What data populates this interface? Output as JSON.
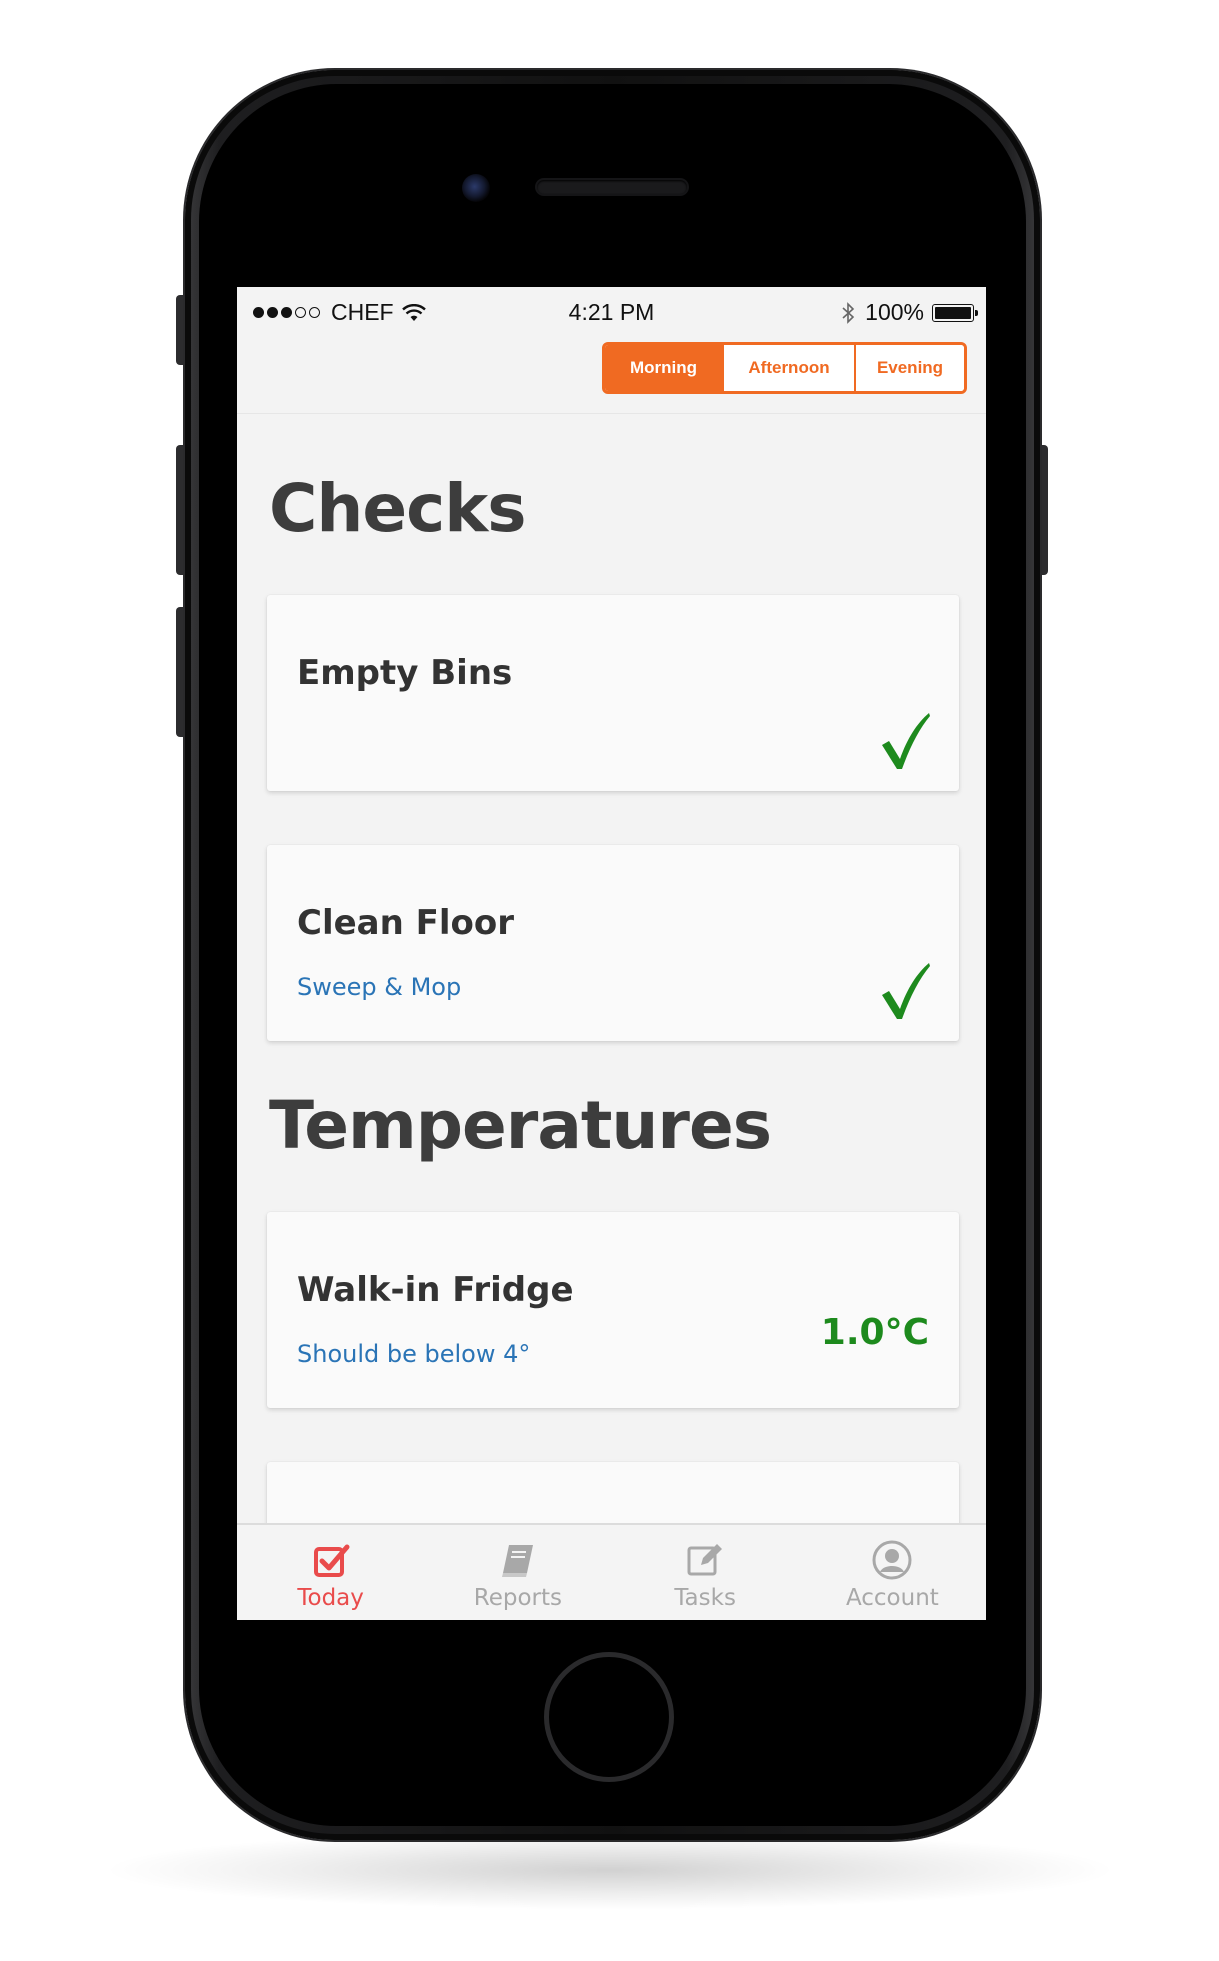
{
  "status_bar": {
    "carrier": "CHEF",
    "time": "4:21 PM",
    "battery_percent": "100%"
  },
  "shift_selector": {
    "options": [
      "Morning",
      "Afternoon",
      "Evening"
    ],
    "selected": "Morning"
  },
  "sections": {
    "checks": {
      "title": "Checks",
      "items": [
        {
          "title": "Empty Bins",
          "subtitle": "",
          "status": "complete"
        },
        {
          "title": "Clean Floor",
          "subtitle": "Sweep & Mop",
          "status": "complete"
        }
      ]
    },
    "temperatures": {
      "title": "Temperatures",
      "items": [
        {
          "title": "Walk-in Fridge",
          "subtitle": "Should be below 4°",
          "value": "1.0°C"
        }
      ]
    }
  },
  "tab_bar": {
    "tabs": [
      {
        "label": "Today",
        "icon": "checkbox-icon",
        "active": true
      },
      {
        "label": "Reports",
        "icon": "book-icon",
        "active": false
      },
      {
        "label": "Tasks",
        "icon": "edit-icon",
        "active": false
      },
      {
        "label": "Account",
        "icon": "user-circle-icon",
        "active": false
      }
    ]
  },
  "colors": {
    "accent_orange": "#f06a22",
    "check_green": "#1d8a1d",
    "link_blue": "#2a74b6",
    "tab_active_red": "#e94b4b"
  }
}
